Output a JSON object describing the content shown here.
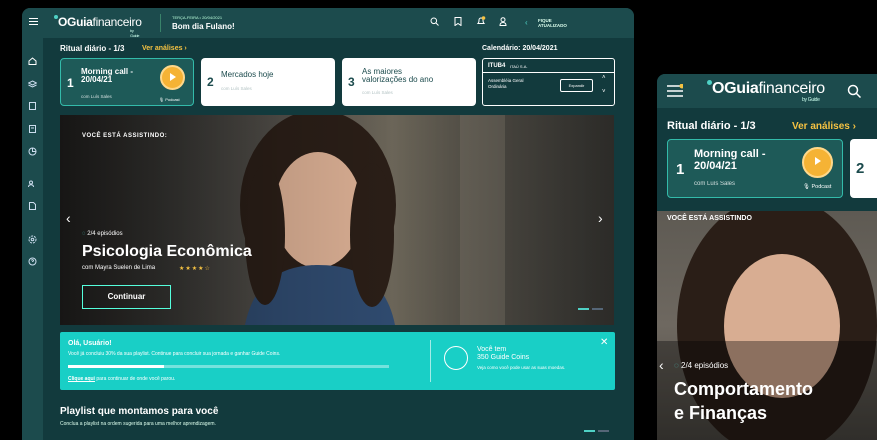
{
  "brand": {
    "name_o": "O",
    "name_guia": "Guia",
    "name_fin": "financeiro",
    "by": "by Guide"
  },
  "header": {
    "date": "TERÇA-FEIRA • 20/04/2021",
    "greeting": "Bom dia Fulano!",
    "fique_1": "FIQUE",
    "fique_2": "ATUALIZADO"
  },
  "sidebar": {
    "items": [
      "home-icon",
      "layers-icon",
      "document-icon",
      "book-icon",
      "chart-pie-icon",
      "people-icon",
      "file-icon",
      "gear-icon",
      "help-icon"
    ]
  },
  "ritual": {
    "title": "Ritual diário - 1/3",
    "link": "Ver análises ›",
    "calendar": "Calendário: 20/04/2021",
    "cards": [
      {
        "num": "1",
        "title_1": "Morning call -",
        "title_2": "20/04/21",
        "by": "com Luís Sales",
        "tag": "Podcast"
      },
      {
        "num": "2",
        "title_1": "Mercados hoje",
        "title_2": "",
        "by": "com Luís Sales",
        "tag": ""
      },
      {
        "num": "3",
        "title_1": "As maiores",
        "title_2": "valorizações do ano",
        "by": "com Luís Sales",
        "tag": ""
      }
    ]
  },
  "stock": {
    "ticker": "ITUB4",
    "company": "ITAÚ S.A.",
    "event_1": "Assembléia Geral",
    "event_2": "Ordinária",
    "button": "Expandir"
  },
  "hero": {
    "label": "VOCÊ ESTÁ ASSISTINDO:",
    "episodes": "2/4 episódios",
    "title": "Psicologia Econômica",
    "by": "com Mayra Suelen de Lima",
    "stars": "★★★★☆",
    "rating": 4,
    "button": "Continuar"
  },
  "promo": {
    "heading": "Olá, Usuário!",
    "text": "Você já concluiu 30% da sua playlist. Continue para concluir sua jornada e ganhar Guide Coins.",
    "progress": 0.3,
    "link_bold": "Clique aqui",
    "link_rest": " para continuar de onde você parou.",
    "coins_1": "Você tem",
    "coins_2": "350 Guide Coins",
    "coins_text": "Veja como você pode usar as suas moedas.",
    "close": "✕"
  },
  "playlist": {
    "heading": "Playlist que montamos para você",
    "subheading": "Conclua a playlist na ordem sugerida para uma melhor aprendizagem."
  },
  "mobile": {
    "ritual": "Ritual diário - 1/3",
    "link": "Ver análises ›",
    "card_num": "1",
    "card_title_1": "Morning call -",
    "card_title_2": "20/04/21",
    "card_by": "com Luís Sales",
    "card_tag": "Podcast",
    "card2_num": "2",
    "label": "VOCÊ ESTÁ ASSISTINDO",
    "episodes": "2/4 episódios",
    "title_1": "Comportamento",
    "title_2": "e Finanças"
  },
  "colors": {
    "bg": "#123a3d",
    "bar": "#1c4b4d",
    "accent": "#19cfc6",
    "gold": "#f5c242"
  }
}
